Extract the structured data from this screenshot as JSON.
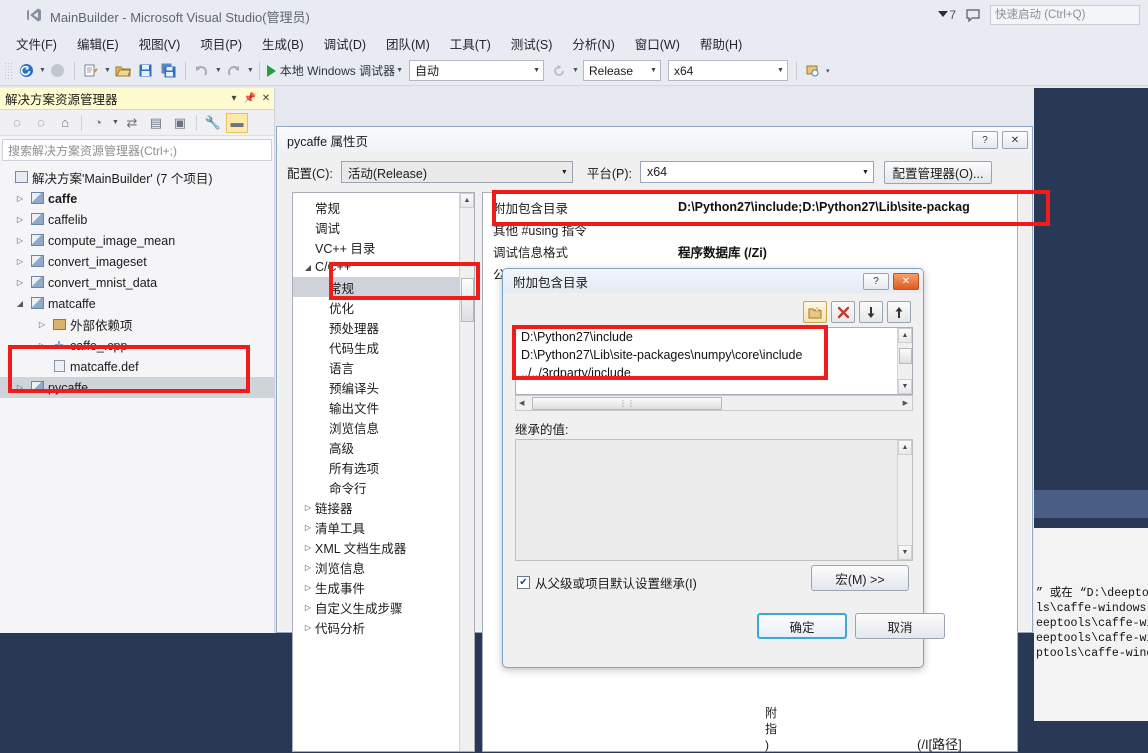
{
  "window": {
    "title": "MainBuilder - Microsoft Visual Studio(管理员)",
    "logo_icon": "visual-studio-logo-icon",
    "warning_icon": "warning-flag-icon",
    "warning_count": "7",
    "feedback_icon": "feedback-icon",
    "quick_launch_placeholder": "快速启动 (Ctrl+Q)"
  },
  "menu": {
    "items": [
      {
        "label": "文件(F)"
      },
      {
        "label": "编辑(E)"
      },
      {
        "label": "视图(V)"
      },
      {
        "label": "项目(P)"
      },
      {
        "label": "生成(B)"
      },
      {
        "label": "调试(D)"
      },
      {
        "label": "团队(M)"
      },
      {
        "label": "工具(T)"
      },
      {
        "label": "测试(S)"
      },
      {
        "label": "分析(N)"
      },
      {
        "label": "窗口(W)"
      },
      {
        "label": "帮助(H)"
      }
    ]
  },
  "toolbar": {
    "nav_back_icon": "navigate-back-icon",
    "nav_fwd_icon": "navigate-forward-icon",
    "new_project_icon": "new-project-icon",
    "open_file_icon": "open-file-icon",
    "save_icon": "save-icon",
    "save_all_icon": "save-all-icon",
    "undo_icon": "undo-icon",
    "redo_icon": "redo-icon",
    "run_icon": "start-debug-icon",
    "run_label": "本地 Windows 调试器",
    "auto_value": "自动",
    "refresh_icon": "refresh-icon",
    "config_value": "Release",
    "platform_value": "x64",
    "overflow_icon": "toolbar-overflow-icon"
  },
  "solution_explorer": {
    "title": "解决方案资源管理器",
    "header_dropdown_icon": "chevron-down-icon",
    "header_pin_icon": "pin-icon",
    "header_close_icon": "close-icon",
    "toolbar_icons": [
      "back-arrow-icon",
      "forward-arrow-icon",
      "home-icon",
      "pending-changes-icon",
      "sync-icon",
      "refresh-view-icon",
      "show-all-files-icon",
      "properties-wrench-icon",
      "preview-pane-icon"
    ],
    "search_placeholder": "搜索解决方案资源管理器(Ctrl+;)",
    "tree": [
      {
        "label": "解决方案'MainBuilder' (7 个项目)",
        "level": 0,
        "icon": "solution-icon",
        "expander": "",
        "bold": false,
        "selected": false
      },
      {
        "label": "caffe",
        "level": 1,
        "icon": "project-icon",
        "expander": "▷",
        "bold": true,
        "selected": false
      },
      {
        "label": "caffelib",
        "level": 1,
        "icon": "project-icon",
        "expander": "▷",
        "bold": false,
        "selected": false
      },
      {
        "label": "compute_image_mean",
        "level": 1,
        "icon": "project-icon",
        "expander": "▷",
        "bold": false,
        "selected": false
      },
      {
        "label": "convert_imageset",
        "level": 1,
        "icon": "project-icon",
        "expander": "▷",
        "bold": false,
        "selected": false
      },
      {
        "label": "convert_mnist_data",
        "level": 1,
        "icon": "project-icon",
        "expander": "▷",
        "bold": false,
        "selected": false
      },
      {
        "label": "matcaffe",
        "level": 1,
        "icon": "project-icon",
        "expander": "◢",
        "bold": false,
        "selected": false
      },
      {
        "label": "外部依赖项",
        "level": 2,
        "icon": "dependencies-icon",
        "expander": "▷",
        "bold": false,
        "selected": false
      },
      {
        "label": "caffe_.cpp",
        "level": 2,
        "icon": "cpp-file-icon",
        "expander": "▷",
        "bold": false,
        "selected": false
      },
      {
        "label": "matcaffe.def",
        "level": 2,
        "icon": "def-file-icon",
        "expander": "",
        "bold": false,
        "selected": false
      },
      {
        "label": "pycaffe",
        "level": 1,
        "icon": "project-icon",
        "expander": "▷",
        "bold": false,
        "selected": true
      }
    ]
  },
  "property_pages": {
    "title": "pycaffe 属性页",
    "help_icon": "help-icon",
    "close_icon": "close-icon",
    "config_label": "配置(C):",
    "config_value": "活动(Release)",
    "platform_label": "平台(P):",
    "platform_value": "x64",
    "config_manager_button": "配置管理器(O)...",
    "tree": [
      {
        "label": "常规",
        "level": 1,
        "expander": "",
        "selected": false
      },
      {
        "label": "调试",
        "level": 1,
        "expander": "",
        "selected": false
      },
      {
        "label": "VC++ 目录",
        "level": 1,
        "expander": "",
        "selected": false
      },
      {
        "label": "C/C++",
        "level": 0,
        "expander": "◢",
        "selected": false
      },
      {
        "label": "常规",
        "level": 2,
        "expander": "",
        "selected": true
      },
      {
        "label": "优化",
        "level": 2,
        "expander": "",
        "selected": false
      },
      {
        "label": "预处理器",
        "level": 2,
        "expander": "",
        "selected": false
      },
      {
        "label": "代码生成",
        "level": 2,
        "expander": "",
        "selected": false
      },
      {
        "label": "语言",
        "level": 2,
        "expander": "",
        "selected": false
      },
      {
        "label": "预编译头",
        "level": 2,
        "expander": "",
        "selected": false
      },
      {
        "label": "输出文件",
        "level": 2,
        "expander": "",
        "selected": false
      },
      {
        "label": "浏览信息",
        "level": 2,
        "expander": "",
        "selected": false
      },
      {
        "label": "高级",
        "level": 2,
        "expander": "",
        "selected": false
      },
      {
        "label": "所有选项",
        "level": 2,
        "expander": "",
        "selected": false
      },
      {
        "label": "命令行",
        "level": 2,
        "expander": "",
        "selected": false
      },
      {
        "label": "链接器",
        "level": 0,
        "expander": "▷",
        "selected": false
      },
      {
        "label": "清单工具",
        "level": 0,
        "expander": "▷",
        "selected": false
      },
      {
        "label": "XML 文档生成器",
        "level": 0,
        "expander": "▷",
        "selected": false
      },
      {
        "label": "浏览信息",
        "level": 0,
        "expander": "▷",
        "selected": false
      },
      {
        "label": "生成事件",
        "level": 0,
        "expander": "▷",
        "selected": false
      },
      {
        "label": "自定义生成步骤",
        "level": 0,
        "expander": "▷",
        "selected": false
      },
      {
        "label": "代码分析",
        "level": 0,
        "expander": "▷",
        "selected": false
      }
    ],
    "grid_rows": [
      {
        "name": "附加包含目录",
        "value": "D:\\Python27\\include;D:\\Python27\\Lib\\site-packag",
        "bold": true
      },
      {
        "name": "其他 #using 指令",
        "value": "",
        "bold": false
      },
      {
        "name": "调试信息格式",
        "value": "程序数据库 (/Zi)",
        "bold": true
      },
      {
        "name": "公共语言运行时支持",
        "value": "",
        "bold": false
      }
    ],
    "bottom_label_fragment": "附加包",
    "inline_flag": "(/I[路径]"
  },
  "include_dirs_dialog": {
    "title": "附加包含目录",
    "help_icon": "help-icon",
    "close_icon": "close-icon",
    "toolbar": [
      {
        "icon": "new-folder-icon",
        "name": "new-line-button"
      },
      {
        "icon": "delete-x-icon",
        "name": "delete-line-button"
      },
      {
        "icon": "move-down-icon",
        "name": "move-down-button"
      },
      {
        "icon": "move-up-icon",
        "name": "move-up-button"
      }
    ],
    "entries": [
      "D:\\Python27\\include",
      "D:\\Python27\\Lib\\site-packages\\numpy\\core\\include",
      "../../3rdparty/include"
    ],
    "inherited_label": "继承的值:",
    "inherited_entries": [],
    "inherit_checkbox_label": "从父级或项目默认设置继承(I)",
    "inherit_checked": true,
    "macro_button": "宏(M) >>",
    "ok_button": "确定",
    "cancel_button": "取消"
  },
  "editor_strip": {
    "code_lines": [
      "” 或在 “D:\\deeptool",
      "ls\\caffe-windows-m",
      "eeptools\\caffe-wind",
      "eeptools\\caffe-wind",
      "ptools\\caffe-window"
    ]
  },
  "annotations": {
    "highlight_color": "#f01c1c",
    "boxes": [
      {
        "name": "pycaffe-project-highlight"
      },
      {
        "name": "cpp-general-node-highlight"
      },
      {
        "name": "additional-include-dirs-row-highlight"
      },
      {
        "name": "include-entries-highlight"
      }
    ]
  }
}
